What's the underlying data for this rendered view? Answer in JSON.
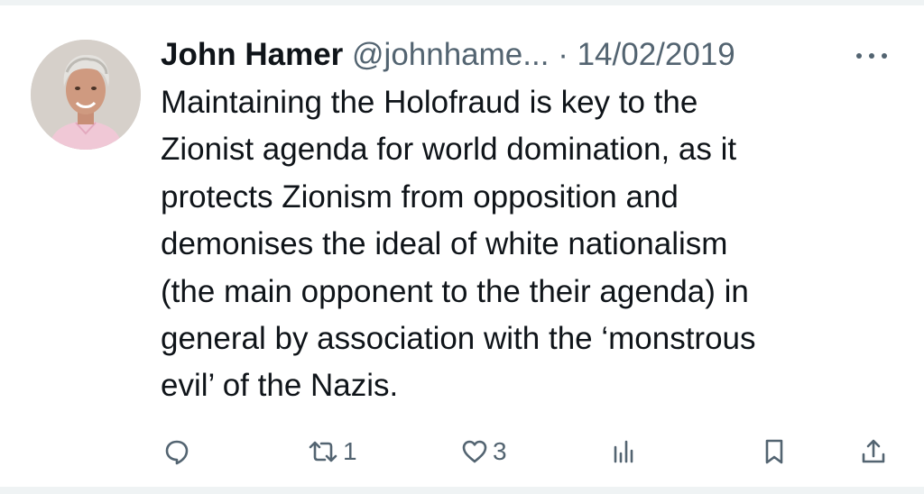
{
  "tweet": {
    "author_name": "John Hamer",
    "handle": "@johnhame...",
    "separator": "·",
    "date": "14/02/2019",
    "text_lines": [
      "Maintaining the Holofraud is key to the",
      "Zionist agenda for world domination, as it",
      "protects Zionism from opposition and",
      "demonises the ideal of white nationalism",
      "(the main opponent to the their agenda) in",
      "general by association with the ‘monstrous",
      "evil’ of the Nazis."
    ]
  },
  "actions": {
    "reply": {
      "icon": "reply-icon",
      "count": ""
    },
    "retweet": {
      "icon": "retweet-icon",
      "count": "1"
    },
    "like": {
      "icon": "heart-icon",
      "count": "3"
    },
    "views": {
      "icon": "analytics-icon",
      "count": ""
    },
    "bookmark": {
      "icon": "bookmark-icon"
    },
    "share": {
      "icon": "share-icon"
    }
  },
  "colors": {
    "text_primary": "#0f1419",
    "text_secondary": "#536471",
    "divider": "#eff3f4"
  }
}
